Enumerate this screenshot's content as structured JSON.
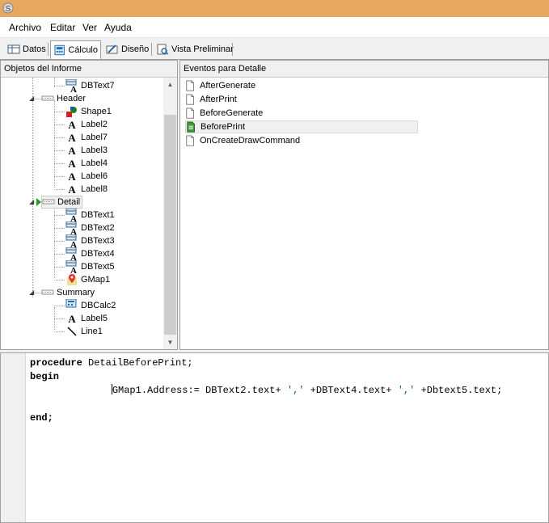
{
  "menu": {
    "items": [
      "Archivo",
      "Editar",
      "Ver",
      "Ayuda"
    ]
  },
  "tabs": [
    {
      "label": "Datos",
      "icon": "table-icon"
    },
    {
      "label": "Cálculo",
      "icon": "calculator-icon",
      "active": true
    },
    {
      "label": "Diseño",
      "icon": "design-icon"
    },
    {
      "label": "Vista Preliminar",
      "icon": "preview-icon"
    }
  ],
  "objects_panel": {
    "title": "Objetos del Informe",
    "items": [
      {
        "label": "DBText7",
        "icon": "dbtext-icon",
        "level": 2
      },
      {
        "label": "Header",
        "icon": "band-icon",
        "level": 1,
        "expanded": true
      },
      {
        "label": "Shape1",
        "icon": "shape-icon",
        "level": 2
      },
      {
        "label": "Label2",
        "icon": "label-icon",
        "level": 2
      },
      {
        "label": "Label7",
        "icon": "label-icon",
        "level": 2
      },
      {
        "label": "Label3",
        "icon": "label-icon",
        "level": 2
      },
      {
        "label": "Label4",
        "icon": "label-icon",
        "level": 2
      },
      {
        "label": "Label6",
        "icon": "label-icon",
        "level": 2
      },
      {
        "label": "Label8",
        "icon": "label-icon",
        "level": 2
      },
      {
        "label": "Detail",
        "icon": "band-icon",
        "level": 1,
        "expanded": true,
        "selected": true
      },
      {
        "label": "DBText1",
        "icon": "dbtext-icon",
        "level": 2
      },
      {
        "label": "DBText2",
        "icon": "dbtext-icon",
        "level": 2
      },
      {
        "label": "DBText3",
        "icon": "dbtext-icon",
        "level": 2
      },
      {
        "label": "DBText4",
        "icon": "dbtext-icon",
        "level": 2
      },
      {
        "label": "DBText5",
        "icon": "dbtext-icon",
        "level": 2
      },
      {
        "label": "GMap1",
        "icon": "map-pin-icon",
        "level": 2
      },
      {
        "label": "Summary",
        "icon": "band-icon",
        "level": 1,
        "expanded": true
      },
      {
        "label": "DBCalc2",
        "icon": "dbcalc-icon",
        "level": 2
      },
      {
        "label": "Label5",
        "icon": "label-icon",
        "level": 2
      },
      {
        "label": "Line1",
        "icon": "line-icon",
        "level": 2
      }
    ]
  },
  "events_panel": {
    "title": "Eventos para Detalle",
    "items": [
      {
        "label": "AfterGenerate",
        "selected": false
      },
      {
        "label": "AfterPrint",
        "selected": false
      },
      {
        "label": "BeforeGenerate",
        "selected": false
      },
      {
        "label": "BeforePrint",
        "selected": true
      },
      {
        "label": "OnCreateDrawCommand",
        "selected": false
      }
    ]
  },
  "editor": {
    "line1_kw": "procedure",
    "line1_rest": " DetailBeforePrint;",
    "line2_kw": "begin",
    "line3_indent": "              ",
    "line3_a": "GMap1.Address:= DBText2.text+ ",
    "line3_s1": "','",
    "line3_b": " +DBText4.text+ ",
    "line3_s2": "','",
    "line3_c": " +Dbtext5.text;",
    "line5_kw": "end;"
  },
  "colors": {
    "titlebar": "#e8a860",
    "string": "#008000"
  }
}
